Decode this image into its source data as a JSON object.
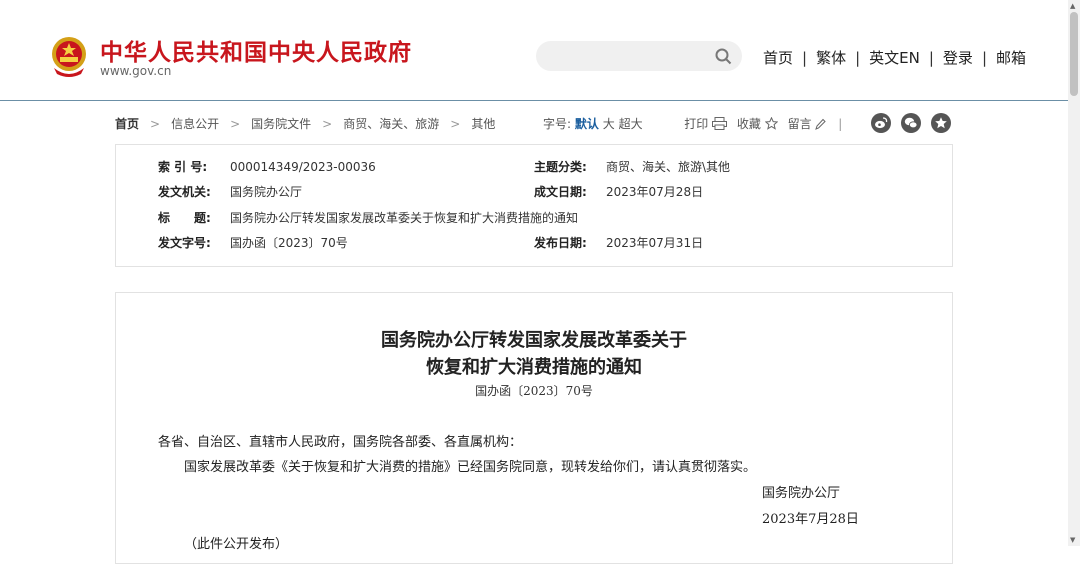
{
  "header": {
    "site_title": "中华人民共和国中央人民政府",
    "site_url": "www.gov.cn",
    "nav": [
      "首页",
      "繁体",
      "英文EN",
      "登录",
      "邮箱"
    ]
  },
  "breadcrumb": [
    "首页",
    "信息公开",
    "国务院文件",
    "商贸、海关、旅游",
    "其他"
  ],
  "tools": {
    "font_label": "字号:",
    "font_default": "默认",
    "font_large": "大",
    "font_xlarge": "超大",
    "print": "打印",
    "favorite": "收藏",
    "comment": "留言"
  },
  "meta": {
    "index_label": "索 引 号:",
    "index_value": "000014349/2023-00036",
    "topic_label": "主题分类:",
    "topic_value": "商贸、海关、旅游\\其他",
    "issuer_label": "发文机关:",
    "issuer_value": "国务院办公厅",
    "date_created_label": "成文日期:",
    "date_created_value": "2023年07月28日",
    "title_label": "标　　题:",
    "title_value": "国务院办公厅转发国家发展改革委关于恢复和扩大消费措施的通知",
    "doc_no_label": "发文字号:",
    "doc_no_value": "国办函〔2023〕70号",
    "pub_date_label": "发布日期:",
    "pub_date_value": "2023年07月31日"
  },
  "document": {
    "title_line1": "国务院办公厅转发国家发展改革委关于",
    "title_line2": "恢复和扩大消费措施的通知",
    "doc_no": "国办函〔2023〕70号",
    "salutation": "各省、自治区、直辖市人民政府，国务院各部委、各直属机构：",
    "body": "国家发展改革委《关于恢复和扩大消费的措施》已经国务院同意，现转发给你们，请认真贯彻落实。",
    "signature": "国务院办公厅",
    "sign_date": "2023年7月28日",
    "note": "（此件公开发布）"
  },
  "colors": {
    "brand_red": "#c8161d",
    "link_blue": "#1a5e9e"
  },
  "icons": [
    "national-emblem-icon",
    "search-icon",
    "print-icon",
    "star-icon",
    "pencil-icon",
    "weibo-icon",
    "wechat-icon",
    "favorite-star-icon"
  ]
}
